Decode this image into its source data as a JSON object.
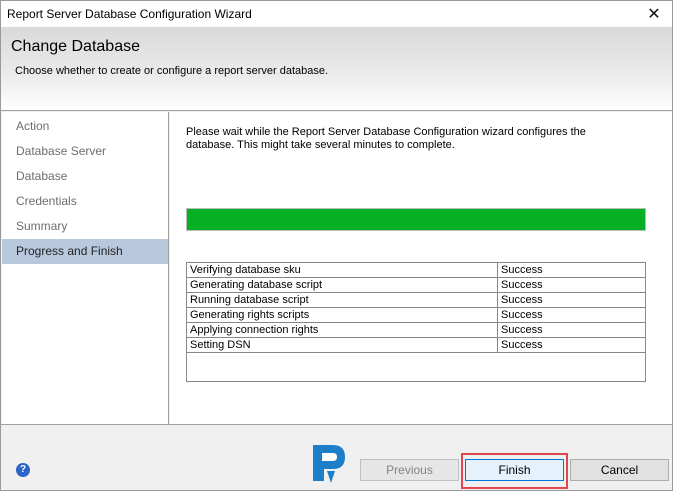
{
  "window": {
    "title": "Report Server Database Configuration Wizard",
    "close_glyph": "✕"
  },
  "header": {
    "title": "Change Database",
    "subtitle": "Choose whether to create or configure a report server database."
  },
  "nav": {
    "items": [
      {
        "label": "Action"
      },
      {
        "label": "Database Server"
      },
      {
        "label": "Database"
      },
      {
        "label": "Credentials"
      },
      {
        "label": "Summary"
      },
      {
        "label": "Progress and Finish",
        "active": true
      }
    ]
  },
  "content": {
    "message": "Please wait while the Report Server Database Configuration wizard configures the database.  This might take several minutes to complete.",
    "progress": 1.0,
    "progress_color": "#06b025",
    "tasks": [
      {
        "task": "Verifying database sku",
        "status": "Success"
      },
      {
        "task": "Generating database script",
        "status": "Success"
      },
      {
        "task": "Running database script",
        "status": "Success"
      },
      {
        "task": "Generating rights scripts",
        "status": "Success"
      },
      {
        "task": "Applying connection rights",
        "status": "Success"
      },
      {
        "task": "Setting DSN",
        "status": "Success"
      }
    ]
  },
  "footer": {
    "help_glyph": "?",
    "logo_icon": "prajwal-desai-logo-icon",
    "previous_label": "Previous",
    "finish_label": "Finish",
    "cancel_label": "Cancel"
  }
}
